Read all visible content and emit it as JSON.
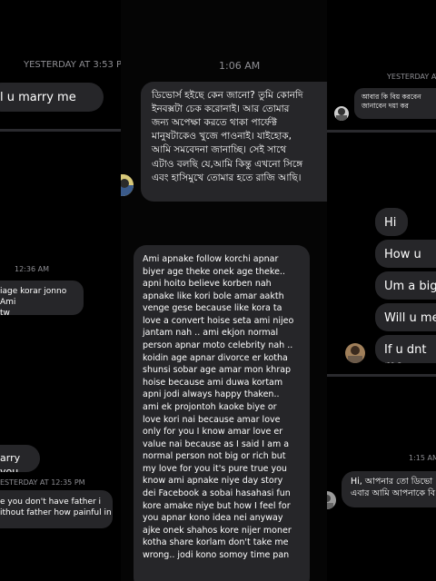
{
  "left_panel": {
    "timestamp_top": "YESTERDAY AT 3:53 P",
    "bubble_top": "l u marry me",
    "timestamp_mid": "12:36 AM",
    "bubble_mid": "iage korar jonno Ami\ntw",
    "bubble_lower": "arry you",
    "timestamp_bottom": "ESTERDAY AT 12:35 PM",
    "bubble_bottom": "e you don't have father i\nithout father how painful in"
  },
  "center_panel": {
    "timestamp": "1:06 AM",
    "bengali_message": "ডিভোর্স হইছে কেন জানো? তুমি কোনদি\nইনবক্সটা চেক করোনাই। আর তোমার\nজন্য অপেক্ষা করতে থাকা পার্ফেক্ট\nমানুষটাকেও খুজে পাওনাই। যাইহোক,\nআমি সমবেদনা জানাচ্ছি। সেই সাথে\nএটাও বলছি যে,আমি কিন্তু এখনো সিঙ্গে\nএবং হাসিমুখে তোমার হতে রাজি আছি।",
    "long_message": "Ami apnake follow korchi apnar\nbiyer age theke onek age theke..\napni hoito believe korben nah\napnake like kori bole amar aakth\nvenge gese because  like kora ta\nlove a convert hoise seta ami nijeo\njantam nah .. ami ekjon normal\nperson apnar moto celebrity nah ..\nkoidin age apnar divorce er kotha\nshunsi sobar age amar mon khrap\nhoise because ami duwa kortam\napni jodi always happy thaken..\nami ek projontoh kaoke biye or\nlove kori nai because amar love\nonly for you I know amar love er\nvalue nai because as I said I am a\nnormal person not big or rich but\nmy love for you it's pure true you\nknow ami apnake niye day story\ndei Facebook a sobai hasahasi fun\nkore amake niye but how I feel for\nyou apnar kono idea nei anyway\najke onek shahos kore nijer moner\nkotha share korlam don't take me\nwrong.. jodi kono somoy time pan"
  },
  "right_panel": {
    "timestamp_top": "YESTERDAY AT 1",
    "bubble_top": "আবার কি বিয় করবেন\nজানাবেন দয়া কর",
    "messages": [
      "Hi",
      "How u",
      "Um a big f",
      "Will u mer",
      "If u dnt me"
    ],
    "timestamp_bottom": "1:15 AM",
    "bubble_bottom": "Hi, আপনার তো ডিভো\nএবার আমি আপনাকে বি"
  }
}
